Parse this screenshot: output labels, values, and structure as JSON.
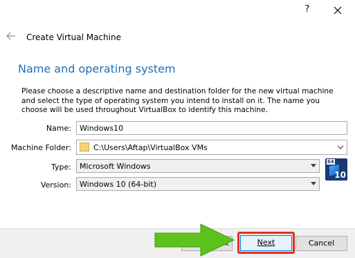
{
  "window": {
    "help_label": "?",
    "close_label": "✕"
  },
  "header": {
    "back_icon": "back-arrow-icon",
    "title": "Create Virtual Machine"
  },
  "section": {
    "title": "Name and operating system",
    "description": "Please choose a descriptive name and destination folder for the new virtual machine and select the type of operating system you intend to install on it. The name you choose will be used throughout VirtualBox to identify this machine."
  },
  "form": {
    "name_label": "Name:",
    "name_value": "Windows10",
    "folder_label": "Machine Folder:",
    "folder_value": "C:\\Users\\Aftap\\VirtualBox VMs",
    "type_label": "Type:",
    "type_value": "Microsoft Windows",
    "version_label": "Version:",
    "version_value": "Windows 10 (64-bit)"
  },
  "os_badge": {
    "top_text": "64",
    "bottom_text": "10"
  },
  "buttons": {
    "back_partial": "k",
    "next": "Next",
    "cancel": "Cancel"
  },
  "colors": {
    "section_title": "#1e6fb8",
    "highlight": "#e0301e",
    "arrow": "#5cc21c"
  }
}
